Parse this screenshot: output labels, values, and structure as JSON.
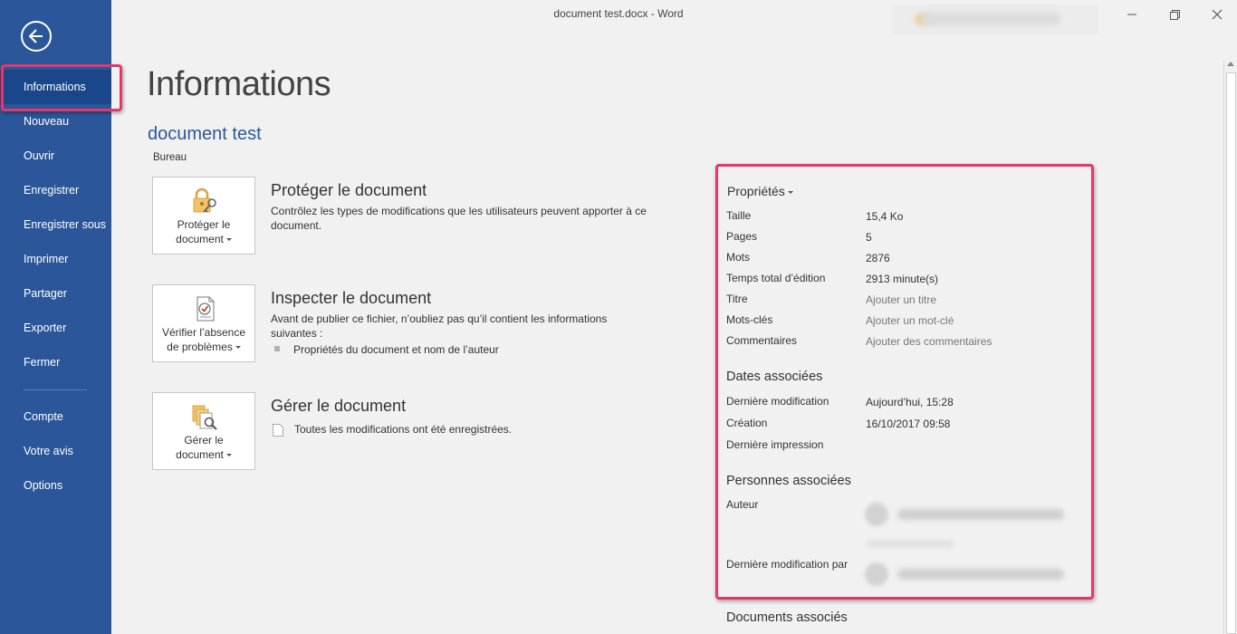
{
  "window": {
    "title": "document test.docx  -  Word"
  },
  "sidebar": {
    "items": [
      {
        "label": "Informations",
        "active": true
      },
      {
        "label": "Nouveau"
      },
      {
        "label": "Ouvrir"
      },
      {
        "label": "Enregistrer"
      },
      {
        "label": "Enregistrer sous"
      },
      {
        "label": "Imprimer"
      },
      {
        "label": "Partager"
      },
      {
        "label": "Exporter"
      },
      {
        "label": "Fermer"
      },
      {
        "label": "Compte"
      },
      {
        "label": "Votre avis"
      },
      {
        "label": "Options"
      }
    ]
  },
  "main": {
    "title": "Informations",
    "doc_name": "document test",
    "doc_location": "Bureau",
    "protect": {
      "button_line1": "Protéger le",
      "button_line2": "document",
      "title": "Protéger le document",
      "description": "Contrôlez les types de modifications que les utilisateurs peuvent apporter à ce document."
    },
    "inspect": {
      "button_line1": "Vérifier l’absence",
      "button_line2": "de problèmes",
      "title": "Inspecter le document",
      "description": "Avant de publier ce fichier, n’oubliez pas qu’il contient les informations suivantes :",
      "bullet": "Propriétés du document et nom de l’auteur"
    },
    "manage": {
      "button_line1": "Gérer le",
      "button_line2": "document",
      "title": "Gérer le document",
      "status": "Toutes les modifications ont été enregistrées."
    }
  },
  "properties": {
    "header": "Propriétés",
    "size_label": "Taille",
    "size_value": "15,4 Ko",
    "pages_label": "Pages",
    "pages_value": "5",
    "words_label": "Mots",
    "words_value": "2876",
    "edit_time_label": "Temps total d’édition",
    "edit_time_value": "2913 minute(s)",
    "title_label": "Titre",
    "title_placeholder": "Ajouter un titre",
    "keywords_label": "Mots-clés",
    "keywords_placeholder": "Ajouter un mot-clé",
    "comments_label": "Commentaires",
    "comments_placeholder": "Ajouter des commentaires",
    "dates_title": "Dates associées",
    "last_modified_label": "Dernière modification",
    "last_modified_value": "Aujourd’hui, 15:28",
    "created_label": "Création",
    "created_value": "16/10/2017 09:58",
    "last_printed_label": "Dernière impression",
    "people_title": "Personnes associées",
    "author_label": "Auteur",
    "last_modified_by_label": "Dernière modification par",
    "related_docs_title": "Documents associés"
  },
  "colors": {
    "sidebar": "#2b579a",
    "accent": "#2b579a",
    "highlight": "#e4376b"
  }
}
